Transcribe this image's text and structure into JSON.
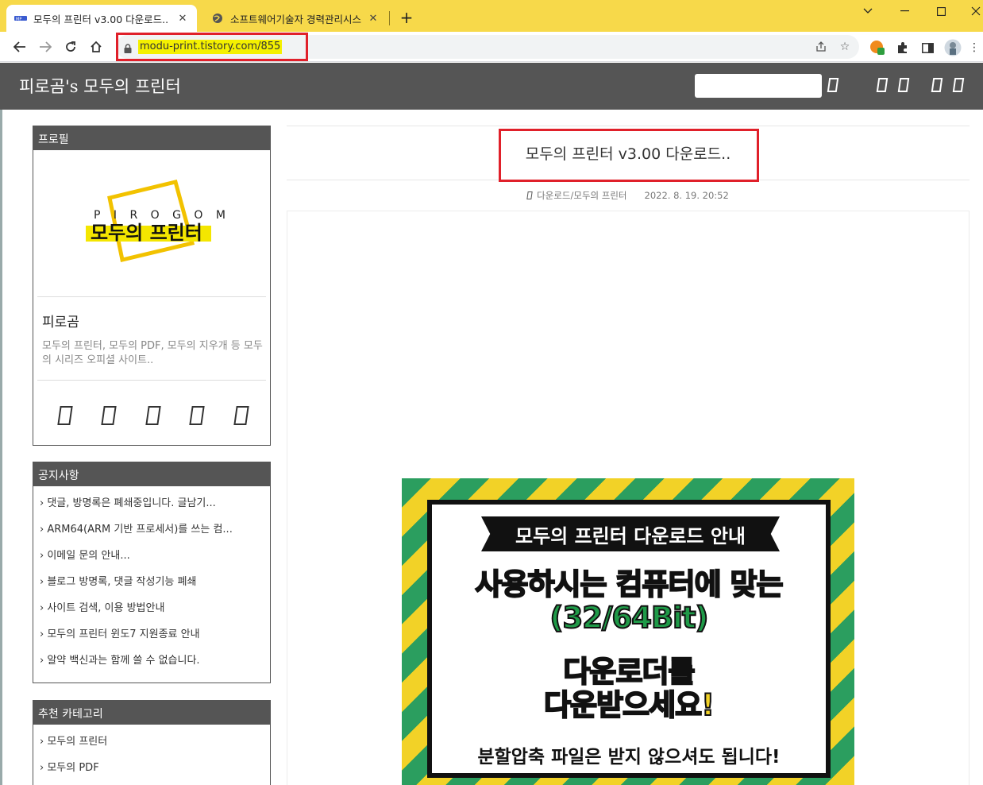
{
  "browser": {
    "tabs": [
      {
        "title": "모두의 프린터 v3.00 다운로드..",
        "favicon": "printer-logo-icon",
        "active": true
      },
      {
        "title": "소프트웨어기술자 경력관리시스",
        "favicon": "globe-icon",
        "active": false
      }
    ],
    "new_tab_label": "+",
    "address": "modu-print.tistory.com/855"
  },
  "blog": {
    "title": "피로곰's 모두의 프린터",
    "search_placeholder": ""
  },
  "sidebar": {
    "profile": {
      "heading": "프로필",
      "logo_top": "P I R O G O M",
      "logo_main": "모두의 프린터",
      "name": "피로곰",
      "description": "모두의 프린터, 모두의 PDF, 모두의 지우개 등 모두의 시리즈 오피셜 사이트.."
    },
    "notice": {
      "heading": "공지사항",
      "items": [
        "› 댓글, 방명록은 폐쇄중입니다. 글남기...",
        "› ARM64(ARM 기반 프로세서)를 쓰는 컴...",
        "› 이메일 문의 안내...",
        "› 블로그 방명록, 댓글 작성기능 폐쇄",
        "› 사이트 검색, 이용 방법안내",
        "› 모두의 프린터 윈도7 지원종료 안내",
        "› 알약 백신과는 함께 쓸 수 없습니다."
      ]
    },
    "recommended": {
      "heading": "추천 카테고리",
      "items": [
        "› 모두의 프린터",
        "› 모두의 PDF"
      ]
    }
  },
  "post": {
    "title": "모두의 프린터 v3.00 다운로드..",
    "category": "다운로드/모두의 프린터",
    "date": "2022. 8. 19. 20:52",
    "banner": {
      "ribbon": "모두의 프린터 다운로드 안내",
      "green_line1": "사용하시는 컴퓨터에 맞는",
      "green_line2": "(32/64Bit)",
      "yellow_line1": "다운로더를",
      "yellow_line2": "다운받으세요!",
      "footer": "분할압축 파일은 받지 않으셔도 됩니다!"
    }
  },
  "colors": {
    "tabstrip": "#f7d94a",
    "header": "#555555",
    "highlight_box": "#e0202a",
    "banner_yellow": "#f2d227",
    "banner_green": "#2b9e5f"
  }
}
